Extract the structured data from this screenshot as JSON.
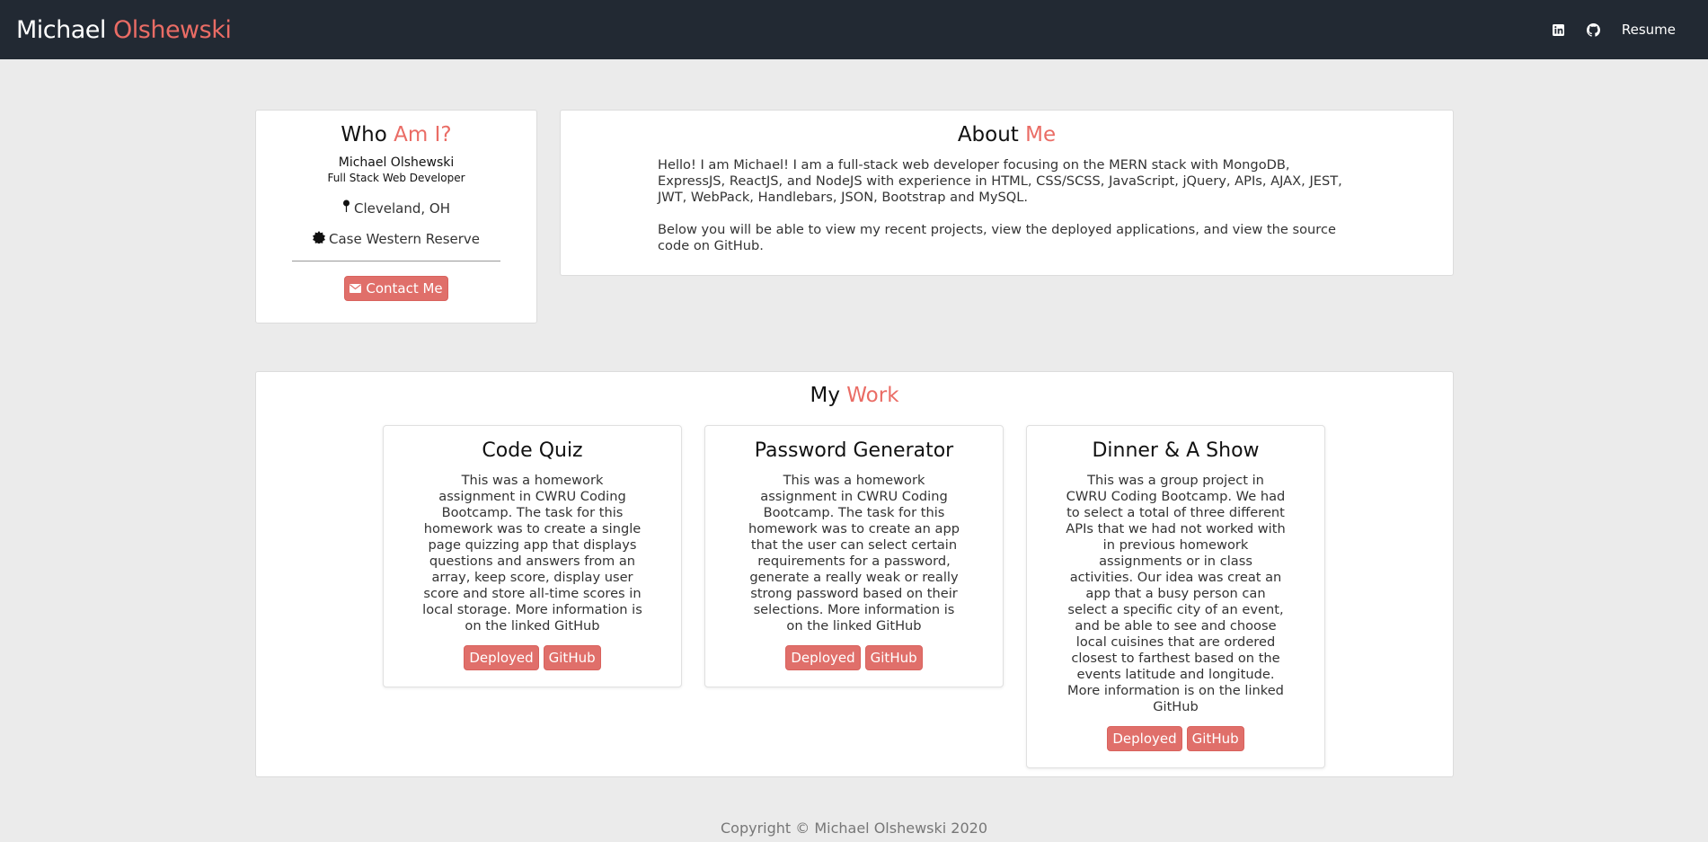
{
  "navbar": {
    "brand_first": "Michael",
    "brand_last": "Olshewski",
    "linkedin_icon": "linkedin-icon",
    "github_icon": "github-icon",
    "resume_label": "Resume"
  },
  "who": {
    "title_plain": "Who",
    "title_accent": "Am I?",
    "name": "Michael Olshewski",
    "role": "Full Stack Web Developer",
    "location": "Cleveland, OH",
    "school": "Case Western Reserve",
    "contact_label": "Contact Me"
  },
  "about": {
    "title_plain": "About",
    "title_accent": "Me",
    "paragraph1": "Hello! I am Michael! I am a full-stack web developer focusing on the MERN stack with MongoDB, ExpressJS, ReactJS, and NodeJS with experience in HTML, CSS/SCSS, JavaScript, jQuery, APIs, AJAX, JEST, JWT, WebPack, Handlebars, JSON, Bootstrap and MySQL.",
    "paragraph2": "Below you will be able to view my recent projects, view the deployed applications, and view the source code on GitHub."
  },
  "work": {
    "title_plain": "My",
    "title_accent": "Work",
    "projects": [
      {
        "title": "Code Quiz",
        "description": "This was a homework assignment in CWRU Coding Bootcamp. The task for this homework was to create a single page quizzing app that displays questions and answers from an array, keep score, display user score and store all-time scores in local storage. More information is on the linked GitHub",
        "deployed_label": "Deployed",
        "github_label": "GitHub"
      },
      {
        "title": "Password Generator",
        "description": "This was a homework assignment in CWRU Coding Bootcamp. The task for this homework was to create an app that the user can select certain requirements for a password, generate a really weak or really strong password based on their selections. More information is on the linked GitHub",
        "deployed_label": "Deployed",
        "github_label": "GitHub"
      },
      {
        "title": "Dinner & A Show",
        "description": "This was a group project in CWRU Coding Bootcamp. We had to select a total of three different APIs that we had not worked with in previous homework assignments or in class activities. Our idea was creat an app that a busy person can select a specific city of an event, and be able to see and choose local cuisines that are ordered closest to farthest based on the events latitude and longitude. More information is on the linked GitHub",
        "deployed_label": "Deployed",
        "github_label": "GitHub"
      }
    ]
  },
  "footer": {
    "copyright": "Copyright © Michael Olshewski 2020"
  },
  "colors": {
    "accent": "#ea6c65",
    "navbar_bg": "#222933",
    "button_bg": "#e06f6a",
    "page_bg": "#ebebeb"
  }
}
